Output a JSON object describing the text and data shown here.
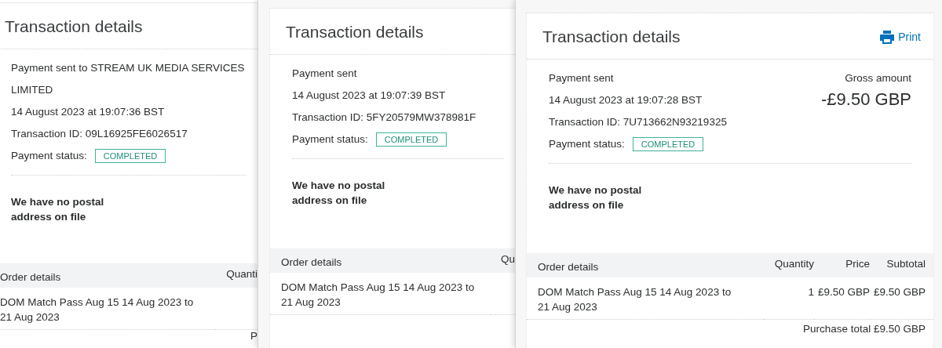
{
  "panels": [
    {
      "title": "Transaction details",
      "lines": [
        "Payment sent to STREAM UK MEDIA SERVICES LIMITED",
        "14 August 2023 at 19:07:36 BST",
        "Transaction ID: 09L16925FE6026517"
      ],
      "status_label": "Payment status:",
      "status": "COMPLETED",
      "address_note": "We have no postal address on file",
      "order": {
        "columns": [
          "Order details",
          "Quanti"
        ],
        "rows": [
          {
            "cells": [
              "DOM Match Pass Aug 15 14 Aug 2023 to 21 Aug 2023"
            ]
          }
        ]
      },
      "total": "P"
    },
    {
      "title": "Transaction details",
      "lines": [
        "Payment sent",
        "14 August 2023 at 19:07:39 BST",
        "Transaction ID: 5FY20579MW378981F"
      ],
      "status_label": "Payment status:",
      "status": "COMPLETED",
      "address_note": "We have no postal address on file",
      "order": {
        "columns": [
          "Order details",
          "Qu"
        ],
        "rows": [
          {
            "cells": [
              "DOM Match Pass Aug 15 14 Aug 2023 to 21 Aug 2023"
            ]
          }
        ]
      }
    },
    {
      "title": "Transaction details",
      "print": "Print",
      "lines": [
        "Payment sent",
        "14 August 2023 at 19:07:28 BST",
        "Transaction ID: 7U713662N93219325"
      ],
      "status_label": "Payment status:",
      "status": "COMPLETED",
      "gross": {
        "label": "Gross amount",
        "amount": "-£9.50 GBP"
      },
      "address_note": "We have no postal address on file",
      "order": {
        "columns": [
          "Order details",
          "Quantity",
          "Price",
          "Subtotal"
        ],
        "rows": [
          {
            "cells": [
              "DOM Match Pass Aug 15 14 Aug 2023 to 21 Aug 2023",
              "1",
              "£9.50 GBP",
              "£9.50 GBP"
            ]
          }
        ]
      },
      "total": "Purchase total £9.50 GBP"
    }
  ]
}
